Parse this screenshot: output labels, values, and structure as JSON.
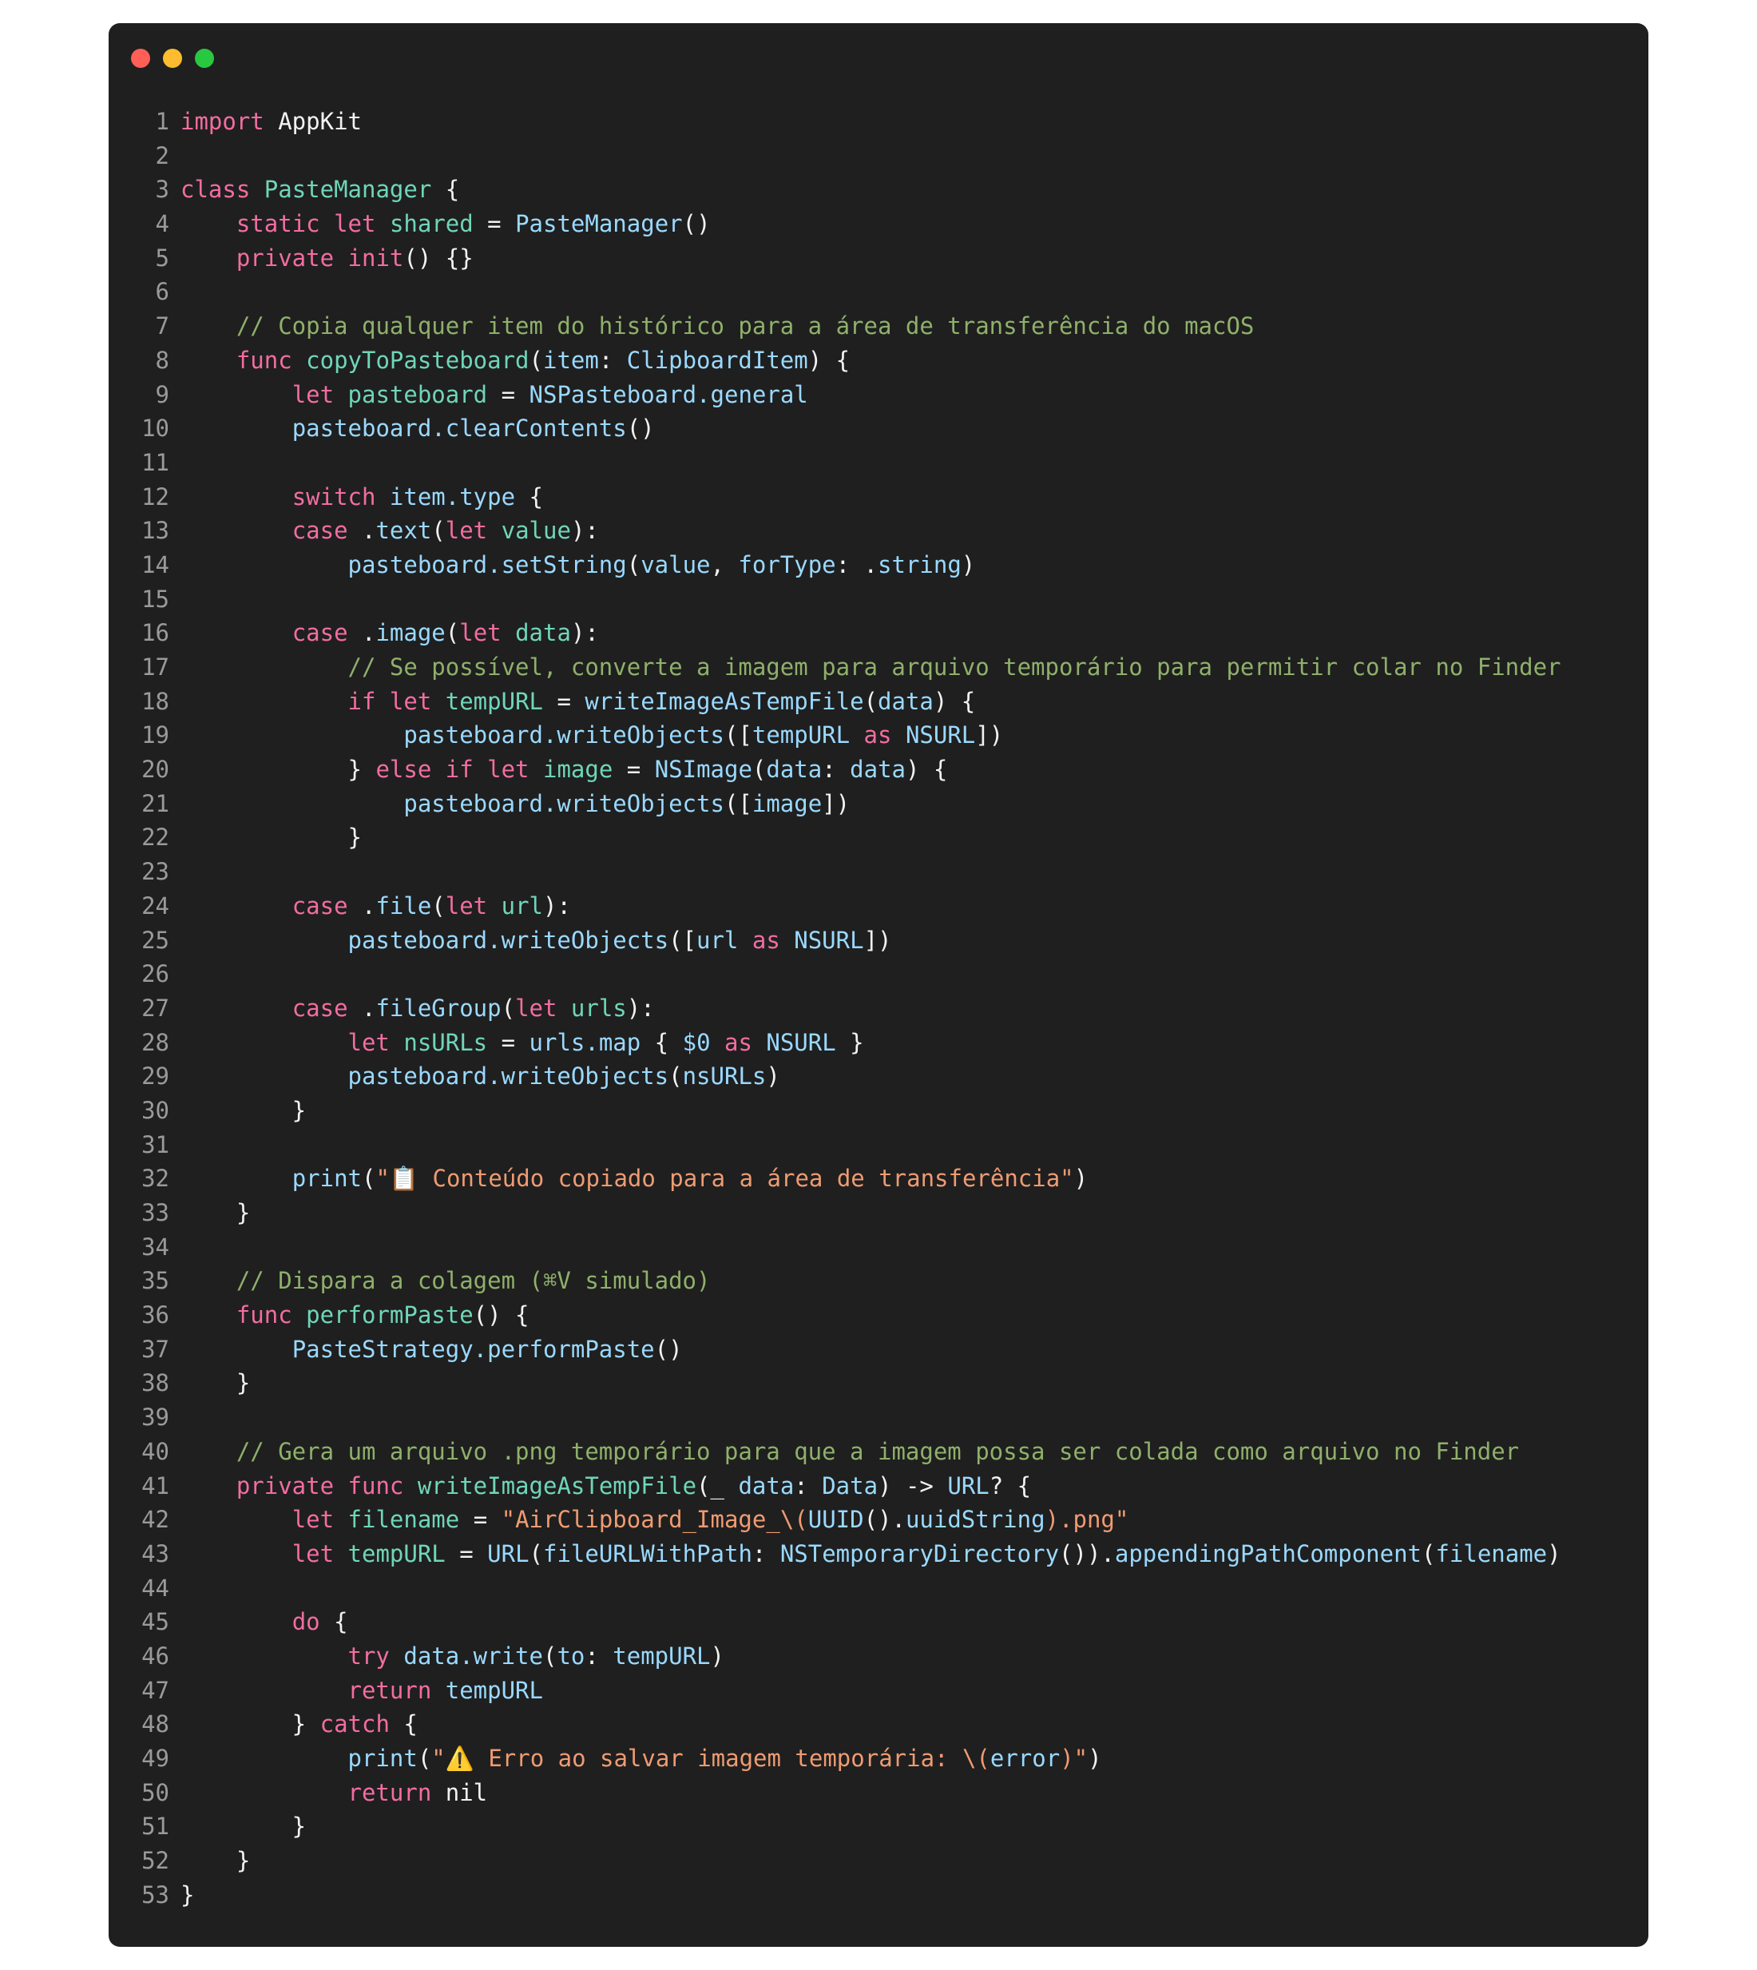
{
  "window": {
    "traffic_lights": [
      {
        "name": "close",
        "color": "#ff5f57"
      },
      {
        "name": "minimize",
        "color": "#febc2e"
      },
      {
        "name": "zoom",
        "color": "#28c840"
      }
    ]
  },
  "theme": {
    "background": "#1f1f1f",
    "keyword": "#f26da0",
    "type": "#6fd6b8",
    "function": "#9ad9ff",
    "string": "#ef9b72",
    "comment": "#8fb06b",
    "plain": "#f2f2f2",
    "line_number": "#9a9a9a"
  },
  "code": {
    "lines": [
      [
        [
          "k",
          "import"
        ],
        [
          "p",
          " AppKit"
        ]
      ],
      [],
      [
        [
          "k",
          "class"
        ],
        [
          "p",
          " "
        ],
        [
          "t",
          "PasteManager"
        ],
        [
          "p",
          " {"
        ]
      ],
      [
        [
          "p",
          "    "
        ],
        [
          "k",
          "static"
        ],
        [
          "p",
          " "
        ],
        [
          "k",
          "let"
        ],
        [
          "p",
          " "
        ],
        [
          "t",
          "shared"
        ],
        [
          "p",
          " = "
        ],
        [
          "f",
          "PasteManager"
        ],
        [
          "p",
          "()"
        ]
      ],
      [
        [
          "p",
          "    "
        ],
        [
          "k",
          "private"
        ],
        [
          "p",
          " "
        ],
        [
          "k",
          "init"
        ],
        [
          "p",
          "() {}"
        ]
      ],
      [],
      [
        [
          "p",
          "    "
        ],
        [
          "c",
          "// Copia qualquer item do histórico para a área de transferência do macOS"
        ]
      ],
      [
        [
          "p",
          "    "
        ],
        [
          "k",
          "func"
        ],
        [
          "p",
          " "
        ],
        [
          "t",
          "copyToPasteboard"
        ],
        [
          "p",
          "("
        ],
        [
          "f",
          "item"
        ],
        [
          "p",
          ": "
        ],
        [
          "f",
          "ClipboardItem"
        ],
        [
          "p",
          ") {"
        ]
      ],
      [
        [
          "p",
          "        "
        ],
        [
          "k",
          "let"
        ],
        [
          "p",
          " "
        ],
        [
          "t",
          "pasteboard"
        ],
        [
          "p",
          " = "
        ],
        [
          "f",
          "NSPasteboard.general"
        ]
      ],
      [
        [
          "p",
          "        "
        ],
        [
          "f",
          "pasteboard.clearContents"
        ],
        [
          "p",
          "()"
        ]
      ],
      [],
      [
        [
          "p",
          "        "
        ],
        [
          "k",
          "switch"
        ],
        [
          "p",
          " "
        ],
        [
          "f",
          "item.type"
        ],
        [
          "p",
          " {"
        ]
      ],
      [
        [
          "p",
          "        "
        ],
        [
          "k",
          "case"
        ],
        [
          "p",
          " ."
        ],
        [
          "f",
          "text"
        ],
        [
          "p",
          "("
        ],
        [
          "k",
          "let"
        ],
        [
          "p",
          " "
        ],
        [
          "t",
          "value"
        ],
        [
          "p",
          "):"
        ]
      ],
      [
        [
          "p",
          "            "
        ],
        [
          "f",
          "pasteboard.setString"
        ],
        [
          "p",
          "("
        ],
        [
          "f",
          "value"
        ],
        [
          "p",
          ", "
        ],
        [
          "f",
          "forType"
        ],
        [
          "p",
          ": ."
        ],
        [
          "f",
          "string"
        ],
        [
          "p",
          ")"
        ]
      ],
      [],
      [
        [
          "p",
          "        "
        ],
        [
          "k",
          "case"
        ],
        [
          "p",
          " ."
        ],
        [
          "f",
          "image"
        ],
        [
          "p",
          "("
        ],
        [
          "k",
          "let"
        ],
        [
          "p",
          " "
        ],
        [
          "t",
          "data"
        ],
        [
          "p",
          "):"
        ]
      ],
      [
        [
          "p",
          "            "
        ],
        [
          "c",
          "// Se possível, converte a imagem para arquivo temporário para permitir colar no Finder"
        ]
      ],
      [
        [
          "p",
          "            "
        ],
        [
          "k",
          "if"
        ],
        [
          "p",
          " "
        ],
        [
          "k",
          "let"
        ],
        [
          "p",
          " "
        ],
        [
          "t",
          "tempURL"
        ],
        [
          "p",
          " = "
        ],
        [
          "f",
          "writeImageAsTempFile"
        ],
        [
          "p",
          "("
        ],
        [
          "f",
          "data"
        ],
        [
          "p",
          ") {"
        ]
      ],
      [
        [
          "p",
          "                "
        ],
        [
          "f",
          "pasteboard.writeObjects"
        ],
        [
          "p",
          "(["
        ],
        [
          "f",
          "tempURL"
        ],
        [
          "p",
          " "
        ],
        [
          "k",
          "as"
        ],
        [
          "p",
          " "
        ],
        [
          "f",
          "NSURL"
        ],
        [
          "p",
          "])"
        ]
      ],
      [
        [
          "p",
          "            } "
        ],
        [
          "k",
          "else"
        ],
        [
          "p",
          " "
        ],
        [
          "k",
          "if"
        ],
        [
          "p",
          " "
        ],
        [
          "k",
          "let"
        ],
        [
          "p",
          " "
        ],
        [
          "t",
          "image"
        ],
        [
          "p",
          " = "
        ],
        [
          "f",
          "NSImage"
        ],
        [
          "p",
          "("
        ],
        [
          "f",
          "data"
        ],
        [
          "p",
          ": "
        ],
        [
          "f",
          "data"
        ],
        [
          "p",
          ") {"
        ]
      ],
      [
        [
          "p",
          "                "
        ],
        [
          "f",
          "pasteboard.writeObjects"
        ],
        [
          "p",
          "(["
        ],
        [
          "f",
          "image"
        ],
        [
          "p",
          "])"
        ]
      ],
      [
        [
          "p",
          "            }"
        ]
      ],
      [],
      [
        [
          "p",
          "        "
        ],
        [
          "k",
          "case"
        ],
        [
          "p",
          " ."
        ],
        [
          "f",
          "file"
        ],
        [
          "p",
          "("
        ],
        [
          "k",
          "let"
        ],
        [
          "p",
          " "
        ],
        [
          "t",
          "url"
        ],
        [
          "p",
          "):"
        ]
      ],
      [
        [
          "p",
          "            "
        ],
        [
          "f",
          "pasteboard.writeObjects"
        ],
        [
          "p",
          "(["
        ],
        [
          "f",
          "url"
        ],
        [
          "p",
          " "
        ],
        [
          "k",
          "as"
        ],
        [
          "p",
          " "
        ],
        [
          "f",
          "NSURL"
        ],
        [
          "p",
          "])"
        ]
      ],
      [],
      [
        [
          "p",
          "        "
        ],
        [
          "k",
          "case"
        ],
        [
          "p",
          " ."
        ],
        [
          "f",
          "fileGroup"
        ],
        [
          "p",
          "("
        ],
        [
          "k",
          "let"
        ],
        [
          "p",
          " "
        ],
        [
          "t",
          "urls"
        ],
        [
          "p",
          "):"
        ]
      ],
      [
        [
          "p",
          "            "
        ],
        [
          "k",
          "let"
        ],
        [
          "p",
          " "
        ],
        [
          "t",
          "nsURLs"
        ],
        [
          "p",
          " = "
        ],
        [
          "f",
          "urls.map"
        ],
        [
          "p",
          " { "
        ],
        [
          "f",
          "$0"
        ],
        [
          "p",
          " "
        ],
        [
          "k",
          "as"
        ],
        [
          "p",
          " "
        ],
        [
          "f",
          "NSURL"
        ],
        [
          "p",
          " }"
        ]
      ],
      [
        [
          "p",
          "            "
        ],
        [
          "f",
          "pasteboard.writeObjects"
        ],
        [
          "p",
          "("
        ],
        [
          "f",
          "nsURLs"
        ],
        [
          "p",
          ")"
        ]
      ],
      [
        [
          "p",
          "        }"
        ]
      ],
      [],
      [
        [
          "p",
          "        "
        ],
        [
          "f",
          "print"
        ],
        [
          "p",
          "("
        ],
        [
          "s",
          "\"📋 Conteúdo copiado para a área de transferência\""
        ],
        [
          "p",
          ")"
        ]
      ],
      [
        [
          "p",
          "    }"
        ]
      ],
      [],
      [
        [
          "p",
          "    "
        ],
        [
          "c",
          "// Dispara a colagem (⌘V simulado)"
        ]
      ],
      [
        [
          "p",
          "    "
        ],
        [
          "k",
          "func"
        ],
        [
          "p",
          " "
        ],
        [
          "t",
          "performPaste"
        ],
        [
          "p",
          "() {"
        ]
      ],
      [
        [
          "p",
          "        "
        ],
        [
          "f",
          "PasteStrategy.performPaste"
        ],
        [
          "p",
          "()"
        ]
      ],
      [
        [
          "p",
          "    }"
        ]
      ],
      [],
      [
        [
          "p",
          "    "
        ],
        [
          "c",
          "// Gera um arquivo .png temporário para que a imagem possa ser colada como arquivo no Finder"
        ]
      ],
      [
        [
          "p",
          "    "
        ],
        [
          "k",
          "private"
        ],
        [
          "p",
          " "
        ],
        [
          "k",
          "func"
        ],
        [
          "p",
          " "
        ],
        [
          "t",
          "writeImageAsTempFile"
        ],
        [
          "p",
          "(_ "
        ],
        [
          "f",
          "data"
        ],
        [
          "p",
          ": "
        ],
        [
          "f",
          "Data"
        ],
        [
          "p",
          ") -> "
        ],
        [
          "f",
          "URL"
        ],
        [
          "p",
          "? {"
        ]
      ],
      [
        [
          "p",
          "        "
        ],
        [
          "k",
          "let"
        ],
        [
          "p",
          " "
        ],
        [
          "t",
          "filename"
        ],
        [
          "p",
          " = "
        ],
        [
          "s",
          "\"AirClipboard_Image_\\("
        ],
        [
          "f",
          "UUID"
        ],
        [
          "p",
          "()."
        ],
        [
          "f",
          "uuidString"
        ],
        [
          "s",
          ").png\""
        ]
      ],
      [
        [
          "p",
          "        "
        ],
        [
          "k",
          "let"
        ],
        [
          "p",
          " "
        ],
        [
          "t",
          "tempURL"
        ],
        [
          "p",
          " = "
        ],
        [
          "f",
          "URL"
        ],
        [
          "p",
          "("
        ],
        [
          "f",
          "fileURLWithPath"
        ],
        [
          "p",
          ": "
        ],
        [
          "f",
          "NSTemporaryDirectory"
        ],
        [
          "p",
          "())."
        ],
        [
          "f",
          "appendingPathComponent"
        ],
        [
          "p",
          "("
        ],
        [
          "f",
          "filename"
        ],
        [
          "p",
          ")"
        ]
      ],
      [],
      [
        [
          "p",
          "        "
        ],
        [
          "k",
          "do"
        ],
        [
          "p",
          " {"
        ]
      ],
      [
        [
          "p",
          "            "
        ],
        [
          "k",
          "try"
        ],
        [
          "p",
          " "
        ],
        [
          "f",
          "data.write"
        ],
        [
          "p",
          "("
        ],
        [
          "f",
          "to"
        ],
        [
          "p",
          ": "
        ],
        [
          "f",
          "tempURL"
        ],
        [
          "p",
          ")"
        ]
      ],
      [
        [
          "p",
          "            "
        ],
        [
          "k",
          "return"
        ],
        [
          "p",
          " "
        ],
        [
          "f",
          "tempURL"
        ]
      ],
      [
        [
          "p",
          "        } "
        ],
        [
          "k",
          "catch"
        ],
        [
          "p",
          " {"
        ]
      ],
      [
        [
          "p",
          "            "
        ],
        [
          "f",
          "print"
        ],
        [
          "p",
          "("
        ],
        [
          "s",
          "\"⚠️ Erro ao salvar imagem temporária: \\("
        ],
        [
          "f",
          "error"
        ],
        [
          "s",
          ")\""
        ],
        [
          "p",
          ")"
        ]
      ],
      [
        [
          "p",
          "            "
        ],
        [
          "k",
          "return"
        ],
        [
          "p",
          " nil"
        ]
      ],
      [
        [
          "p",
          "        }"
        ]
      ],
      [
        [
          "p",
          "    }"
        ]
      ],
      [
        [
          "p",
          "}"
        ]
      ]
    ]
  }
}
